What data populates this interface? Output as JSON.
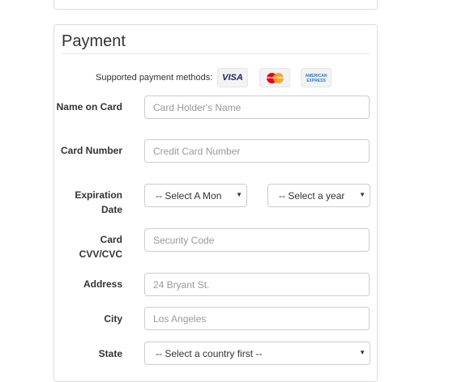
{
  "payment": {
    "title": "Payment",
    "supported_methods_label": "Supported payment methods:",
    "cards": {
      "visa": "VISA",
      "mastercard": "MasterCard",
      "amex": "AMERICAN EXPRESS"
    },
    "fields": {
      "name_label": "Name on Card",
      "name_placeholder": "Card Holder's Name",
      "number_label": "Card Number",
      "number_placeholder": "Credit Card Number",
      "expiration_label": "Expiration Date",
      "month_select": "-- Select A Mon",
      "year_select": "-- Select a year",
      "cvv_label": "Card CVV/CVC",
      "cvv_placeholder": "Security Code",
      "address_label": "Address",
      "address_placeholder": "24 Bryant St.",
      "city_label": "City",
      "city_placeholder": "Los Angeles",
      "state_label": "State",
      "state_select": "-- Select a country first --"
    }
  },
  "colors": {
    "border": "#cccccc",
    "panel_border": "#dddddd",
    "visa_blue": "#1a1f71",
    "amex_blue": "#2e77bb",
    "mc_red": "#eb001b",
    "mc_orange": "#f79e1b"
  }
}
